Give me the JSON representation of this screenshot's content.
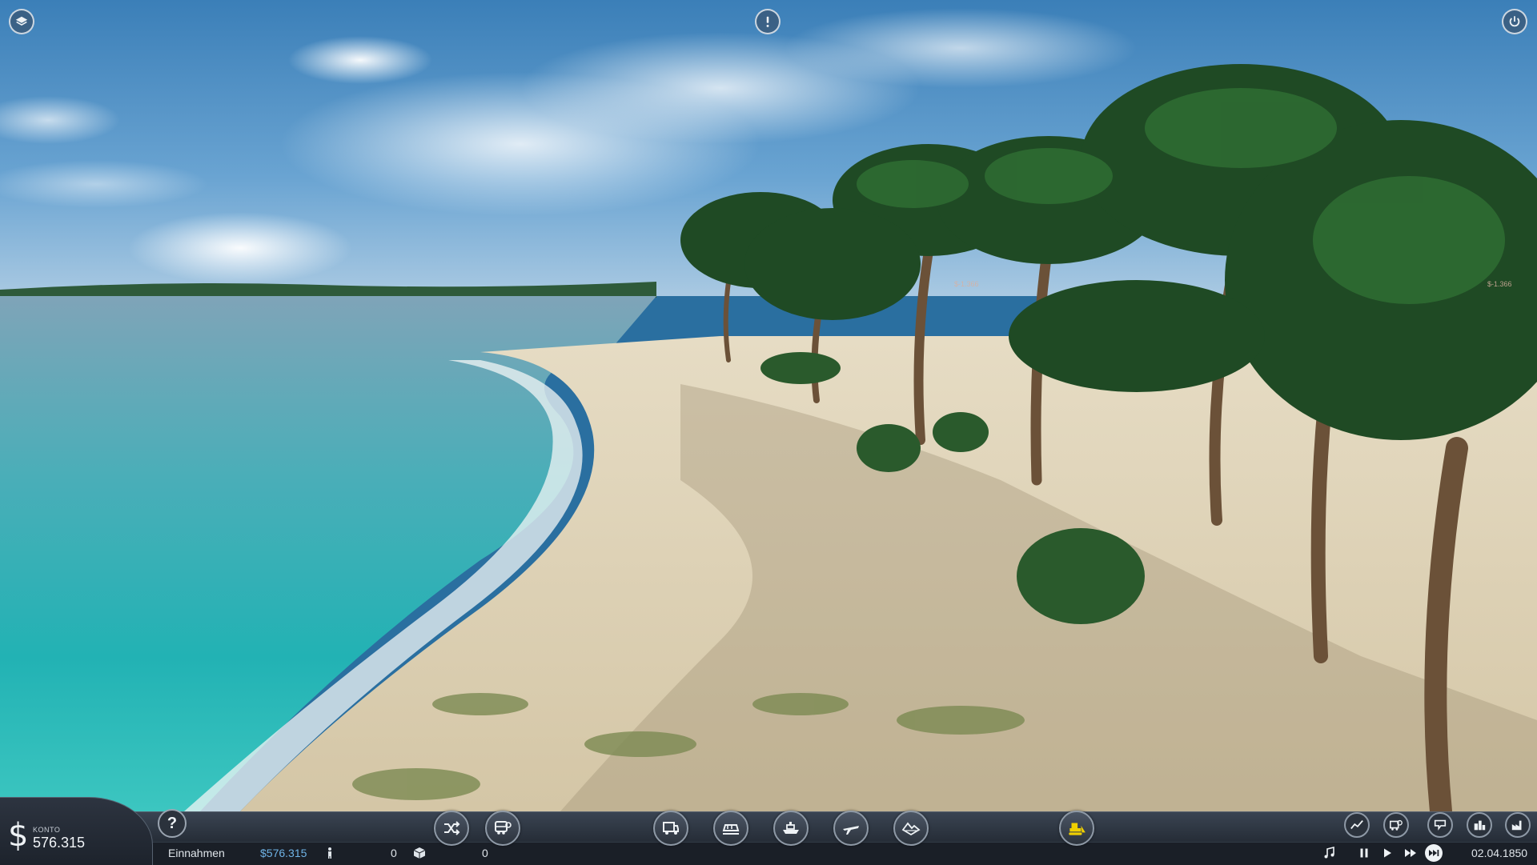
{
  "hud": {
    "account_label": "KONTO",
    "account_value": "576.315",
    "income_label": "Einnahmen",
    "income_value": "$576.315",
    "passengers_value": "0",
    "cargo_value": "0",
    "date": "02.04.1850"
  },
  "scene_labels": {
    "left": "$-1.366",
    "right": "$-1.366"
  },
  "toolbar_icons": [
    "shuffle-icon",
    "bus-manage-icon",
    "road-vehicle-icon",
    "train-icon",
    "ship-icon",
    "plane-icon",
    "terrain-icon",
    "bulldozer-icon"
  ],
  "colors": {
    "accent_blue": "#6fb3e6",
    "bulldozer_yellow": "#f0d000",
    "hud_dark": "#1a1f27"
  }
}
